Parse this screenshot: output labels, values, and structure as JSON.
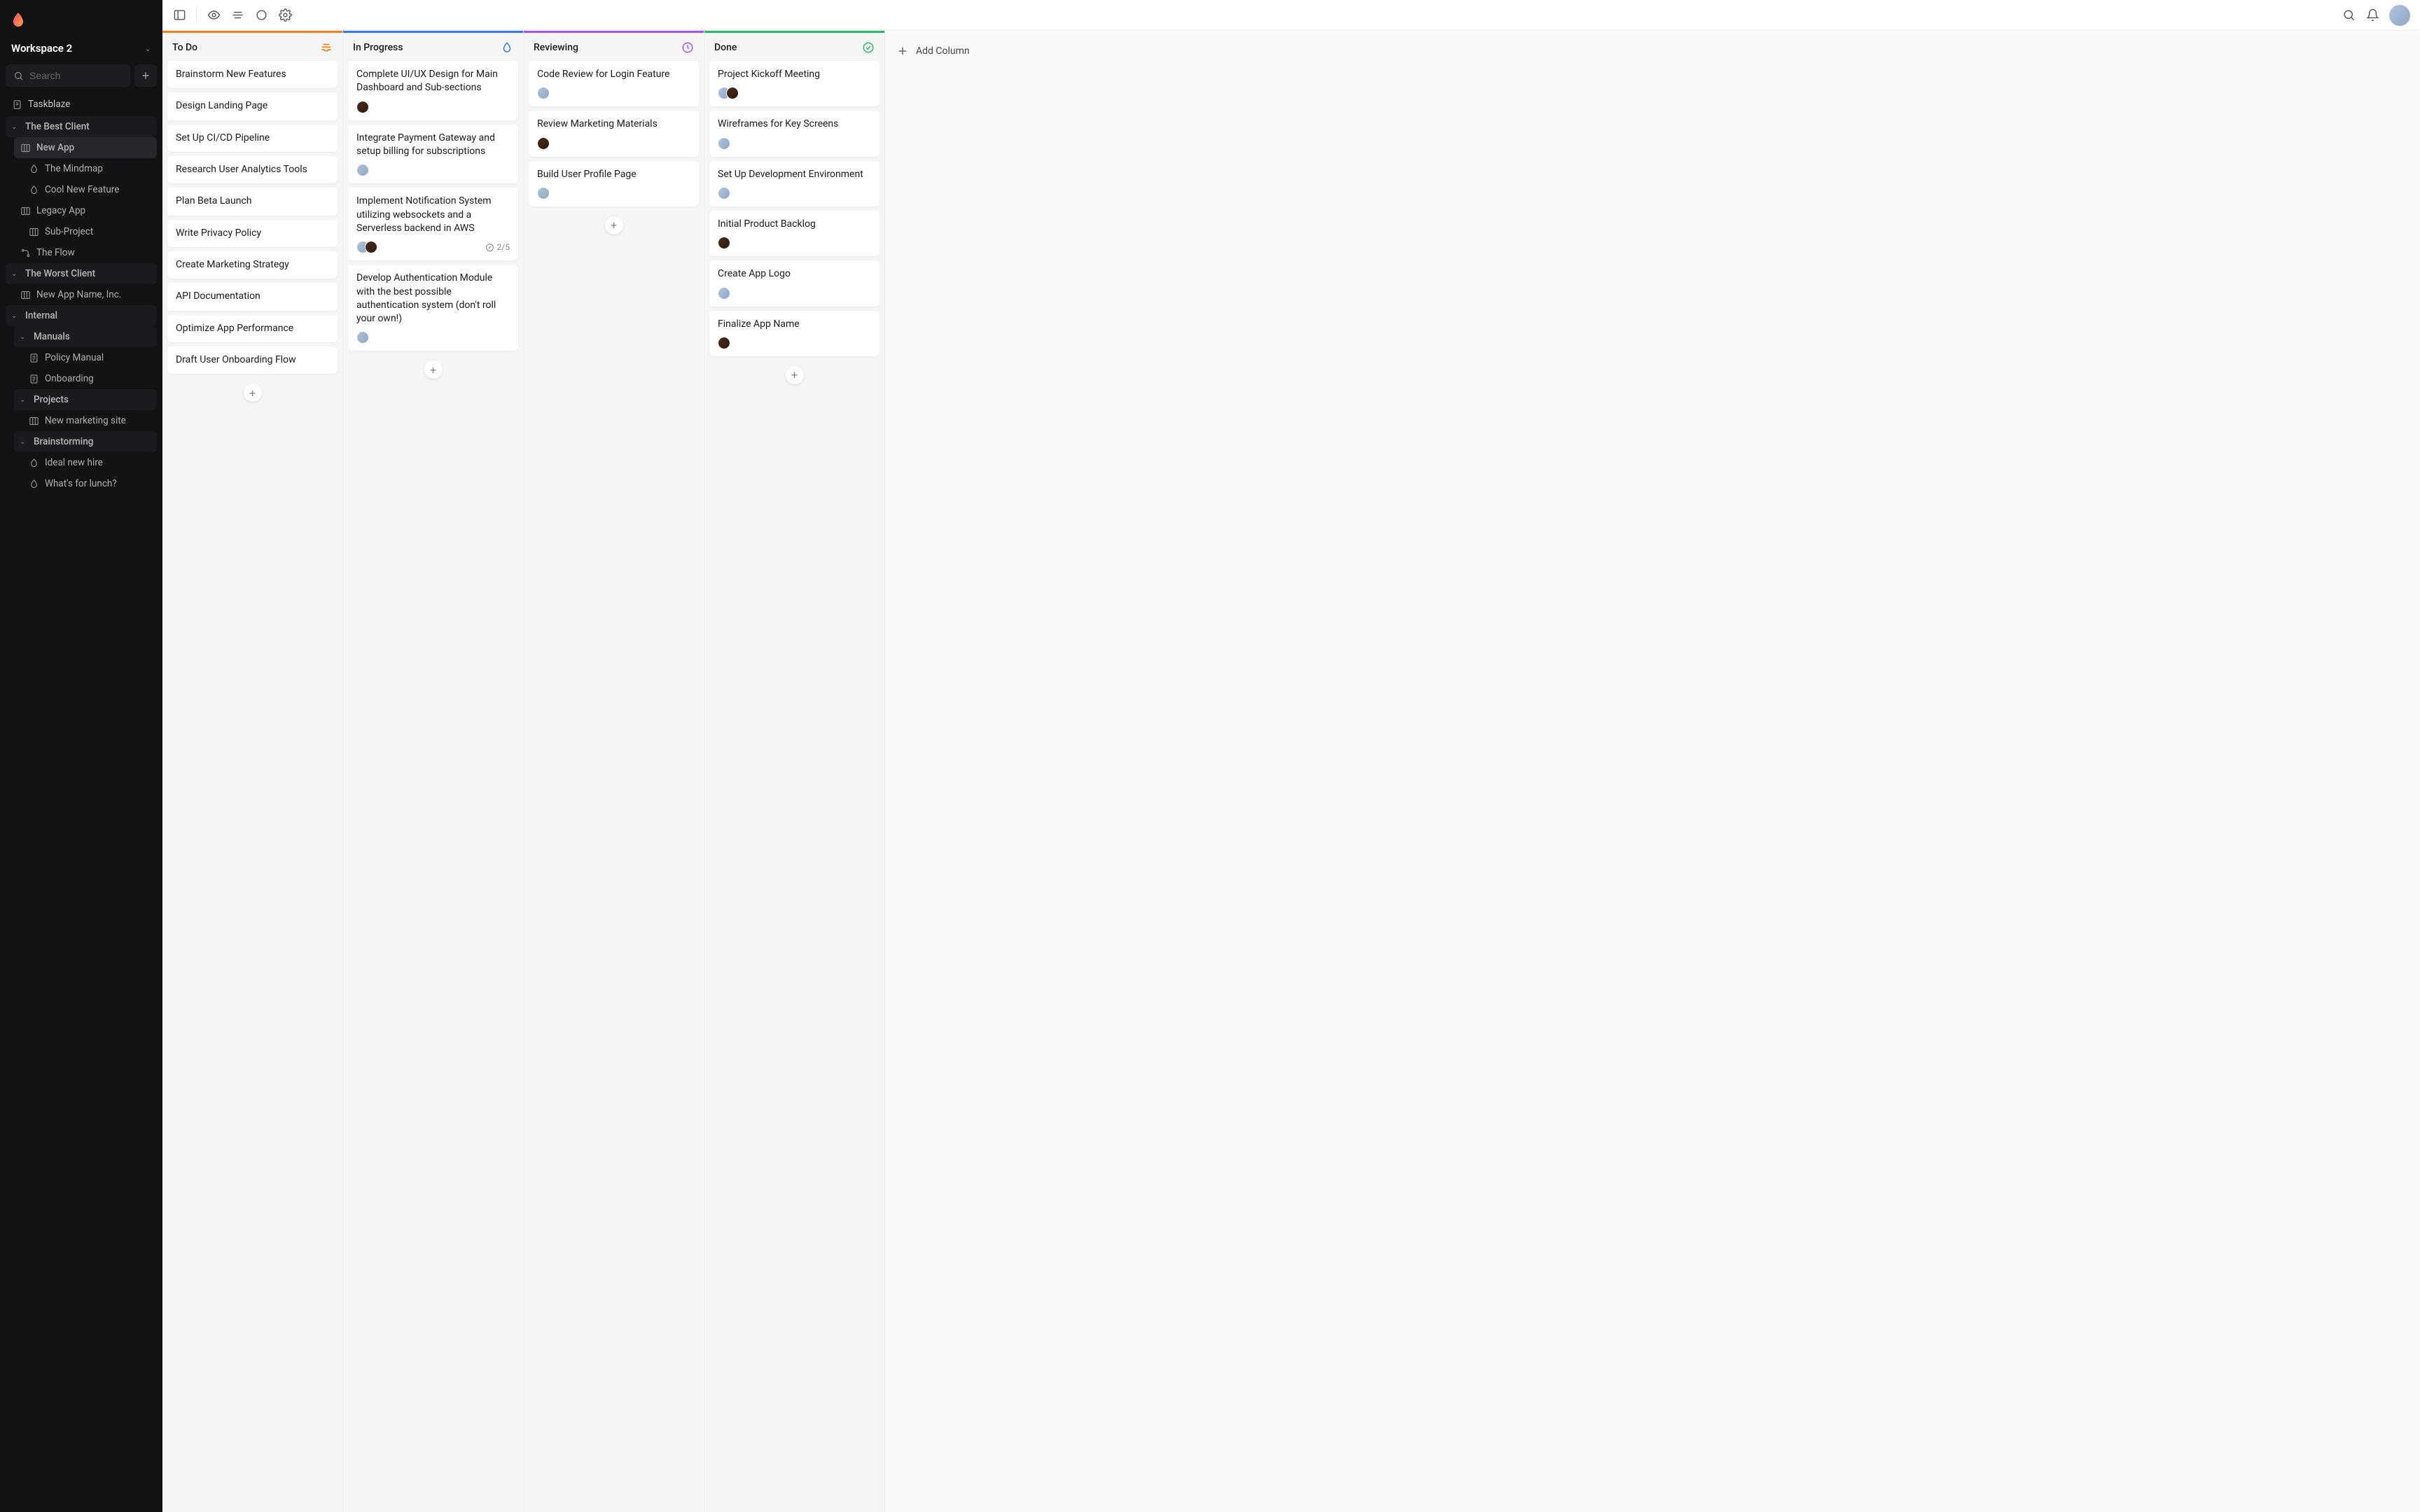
{
  "workspace": {
    "name": "Workspace 2"
  },
  "search": {
    "placeholder": "Search"
  },
  "sidebar": {
    "root": "Taskblaze",
    "items": [
      {
        "label": "The Best Client",
        "type": "group"
      },
      {
        "label": "New App",
        "icon": "board",
        "active": true
      },
      {
        "label": "The Mindmap",
        "icon": "flame"
      },
      {
        "label": "Cool New Feature",
        "icon": "flame"
      },
      {
        "label": "Legacy App",
        "icon": "board"
      },
      {
        "label": "Sub-Project",
        "icon": "board"
      },
      {
        "label": "The Flow",
        "icon": "flow"
      },
      {
        "label": "The Worst Client",
        "type": "group"
      },
      {
        "label": "New App Name, Inc.",
        "icon": "board"
      },
      {
        "label": "Internal",
        "type": "group"
      },
      {
        "label": "Manuals",
        "type": "subgroup"
      },
      {
        "label": "Policy Manual",
        "icon": "doc"
      },
      {
        "label": "Onboarding",
        "icon": "doc"
      },
      {
        "label": "Projects",
        "type": "subgroup"
      },
      {
        "label": "New marketing site",
        "icon": "board"
      },
      {
        "label": "Brainstorming",
        "type": "subgroup"
      },
      {
        "label": "Ideal new hire",
        "icon": "flame"
      },
      {
        "label": "What's for lunch?",
        "icon": "flame"
      }
    ]
  },
  "columns": [
    {
      "title": "To Do",
      "accent": "#f5821f",
      "icon": "inbox",
      "iconColor": "#f5821f",
      "cards": [
        {
          "title": "Brainstorm New Features"
        },
        {
          "title": "Design Landing Page"
        },
        {
          "title": "Set Up CI/CD Pipeline"
        },
        {
          "title": "Research User Analytics Tools"
        },
        {
          "title": "Plan Beta Launch"
        },
        {
          "title": "Write Privacy Policy"
        },
        {
          "title": "Create Marketing Strategy"
        },
        {
          "title": "API Documentation"
        },
        {
          "title": "Optimize App Performance"
        },
        {
          "title": "Draft User Onboarding Flow"
        }
      ]
    },
    {
      "title": "In Progress",
      "accent": "#3478f6",
      "icon": "flame",
      "iconColor": "#3478f6",
      "cards": [
        {
          "title": "Complete UI/UX Design for Main Dashboard and Sub-sections",
          "avatars": [
            "av2"
          ]
        },
        {
          "title": "Integrate Payment Gateway and setup billing for subscriptions",
          "avatars": [
            "av1"
          ]
        },
        {
          "title": "Implement Notification System utilizing websockets and a Serverless backend in AWS",
          "avatars": [
            "av1",
            "av2"
          ],
          "subtasks": "2/5"
        },
        {
          "title": "Develop Authentication Module with the best possible authentication system (don't roll your own!)",
          "avatars": [
            "av1"
          ]
        }
      ]
    },
    {
      "title": "Reviewing",
      "accent": "#a056f7",
      "icon": "clock",
      "iconColor": "#a056f7",
      "cards": [
        {
          "title": "Code Review for Login Feature",
          "avatars": [
            "av1"
          ]
        },
        {
          "title": "Review Marketing Materials",
          "avatars": [
            "av2"
          ]
        },
        {
          "title": "Build User Profile Page",
          "avatars": [
            "av1"
          ]
        }
      ]
    },
    {
      "title": "Done",
      "accent": "#2ab96a",
      "icon": "check",
      "iconColor": "#2ab96a",
      "cards": [
        {
          "title": "Project Kickoff Meeting",
          "avatars": [
            "av1",
            "av2"
          ]
        },
        {
          "title": "Wireframes for Key Screens",
          "avatars": [
            "av1"
          ]
        },
        {
          "title": "Set Up Development Environment",
          "avatars": [
            "av1"
          ]
        },
        {
          "title": "Initial Product Backlog",
          "avatars": [
            "av2"
          ]
        },
        {
          "title": "Create App Logo",
          "avatars": [
            "av1"
          ]
        },
        {
          "title": "Finalize App Name",
          "avatars": [
            "av2"
          ]
        }
      ]
    }
  ],
  "addColumnLabel": "Add Column"
}
